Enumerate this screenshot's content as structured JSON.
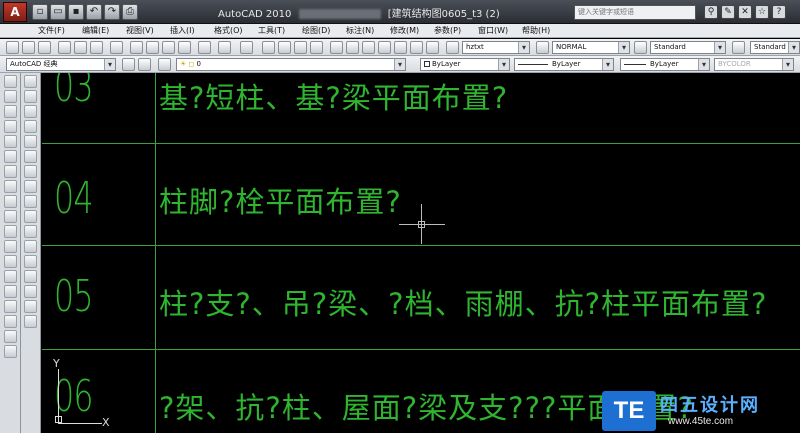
{
  "titlebar": {
    "app_logo": "A",
    "title_left": "AutoCAD 2010",
    "title_right": "[建筑结构图0605_t3 (2)",
    "search_placeholder": "键入关键字或短语"
  },
  "menu": [
    "文件(F)",
    "编辑(E)",
    "视图(V)",
    "插入(I)",
    "格式(O)",
    "工具(T)",
    "绘图(D)",
    "标注(N)",
    "修改(M)",
    "参数(P)",
    "窗口(W)",
    "帮助(H)"
  ],
  "toolbar1": {
    "text_style": "hztxt",
    "dim_style": "NORMAL",
    "table_style": "Standard",
    "multileader_style": "Standard"
  },
  "toolbar2": {
    "workspace": "AutoCAD 经典",
    "layer": "0",
    "color": "ByLayer",
    "linetype": "ByLayer",
    "lineweight": "ByLayer",
    "plotstyle": "BYCOLOR"
  },
  "drawing": {
    "rows": [
      {
        "num": "03",
        "text": "基?短柱、基?梁平面布置?"
      },
      {
        "num": "04",
        "text": "柱脚?栓平面布置?"
      },
      {
        "num": "05",
        "text": "柱?支?、吊?梁、?档、雨棚、抗?柱平面布置?"
      },
      {
        "num": "06",
        "text": "?架、抗?柱、屋面?梁及支???平面布置?"
      }
    ],
    "ucs_x": "X",
    "ucs_y": "Y"
  },
  "watermark": {
    "badge": "TE",
    "name": "四五设计网",
    "url": "www.45te.com"
  }
}
